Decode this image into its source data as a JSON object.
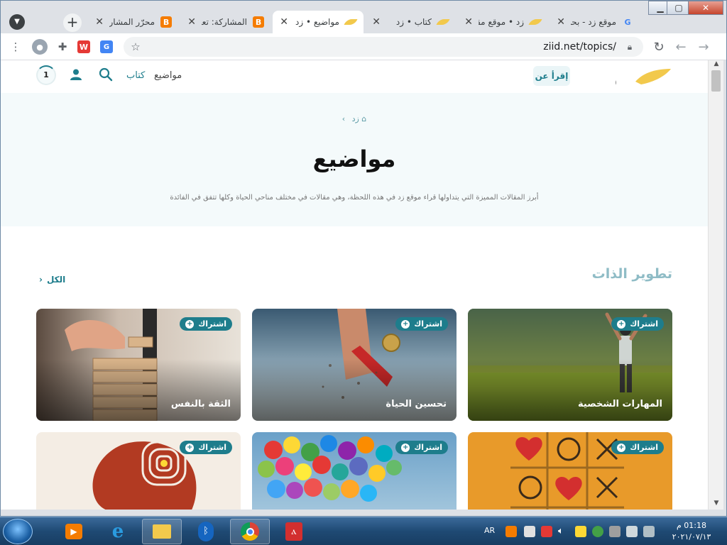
{
  "browser": {
    "tabs": [
      {
        "title": "موقع زد - بحث",
        "favicon": "google-icon"
      },
      {
        "title": "زد • موقع مقالات",
        "favicon": "ziid-icon"
      },
      {
        "title": "كتاب • زد",
        "favicon": "ziid-icon"
      },
      {
        "title": "مواضيع • زد",
        "favicon": "ziid-icon",
        "active": true
      },
      {
        "title": "المشاركة: تعديل",
        "favicon": "blogger-icon"
      },
      {
        "title": "محرّر المشاركات",
        "favicon": "blogger-icon"
      }
    ],
    "new_tab": "+",
    "url": "ziid.net/topics/",
    "window_controls": {
      "minimize": "▁",
      "maximize": "▢",
      "close": "✕"
    }
  },
  "site": {
    "logo_text": "زد",
    "read_about_button": "إقرأ عن",
    "nav": {
      "topics": "مواضيع",
      "writers": "كتاب"
    },
    "notification_count": "1",
    "breadcrumb": {
      "home": "زد",
      "separator": "›"
    },
    "page_title": "مواضيع",
    "page_subtitle": "أبرز المقالات المميزة التي يتداولها قراء موقع زد في هذه اللحظة، وهي مقالات في مختلف مناحي الحياة وكلها تتفق في الفائدة",
    "section": {
      "title": "تطوير الذات",
      "see_all": "الكل"
    },
    "subscribe_label": "اشتراك",
    "cards_row1": [
      {
        "title": "المهارات الشخصية",
        "image": "man-raising-arms-field"
      },
      {
        "title": "تحسين الحياة",
        "image": "hand-holding-medal"
      },
      {
        "title": "الثقة بالنفس",
        "image": "hand-stacking-blocks"
      }
    ],
    "cards_row2": [
      {
        "title": "",
        "image": "tic-tac-toe-hearts"
      },
      {
        "title": "",
        "image": "colorful-balloons"
      },
      {
        "title": "",
        "image": "head-maze-lightbulb"
      }
    ],
    "accent_color": "#1e7d8c"
  },
  "taskbar": {
    "language": "AR",
    "time": "01:18 م",
    "date": "٢٠٢١/٠٧/١٣"
  }
}
